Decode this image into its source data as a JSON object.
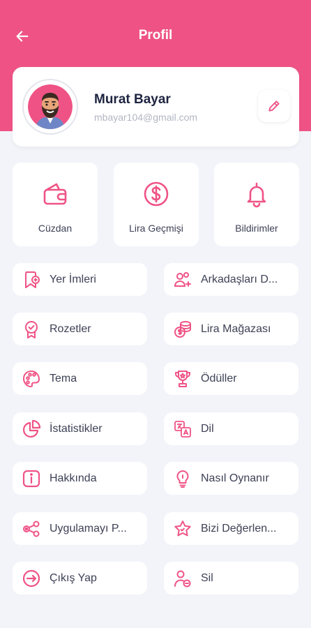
{
  "header": {
    "title": "Profil",
    "back_icon": "arrow-left-icon",
    "accent": "#ef5386"
  },
  "profile": {
    "name": "Murat Bayar",
    "email": "mbayar104@gmail.com",
    "edit_icon": "pencil-icon"
  },
  "quick_actions": [
    {
      "label": "Cüzdan",
      "icon": "wallet-icon"
    },
    {
      "label": "Lira Geçmişi",
      "icon": "dollar-coin-icon"
    },
    {
      "label": "Bildirimler",
      "icon": "bell-icon"
    }
  ],
  "menu": [
    {
      "label": "Yer İmleri",
      "icon": "bookmark-add-icon"
    },
    {
      "label": "Arkadaşları D...",
      "icon": "add-friends-icon"
    },
    {
      "label": "Rozetler",
      "icon": "badge-icon"
    },
    {
      "label": "Lira Mağazası",
      "icon": "coin-stack-icon"
    },
    {
      "label": "Tema",
      "icon": "palette-icon"
    },
    {
      "label": "Ödüller",
      "icon": "trophy-icon"
    },
    {
      "label": "İstatistikler",
      "icon": "pie-chart-icon"
    },
    {
      "label": "Dil",
      "icon": "translate-icon"
    },
    {
      "label": "Hakkında",
      "icon": "info-icon"
    },
    {
      "label": "Nasıl Oynanır",
      "icon": "lightbulb-icon"
    },
    {
      "label": "Uygulamayı P...",
      "icon": "share-icon"
    },
    {
      "label": "Bizi Değerlen...",
      "icon": "star-icon"
    },
    {
      "label": "Çıkış Yap",
      "icon": "logout-icon"
    },
    {
      "label": "Sil",
      "icon": "delete-user-icon"
    }
  ]
}
